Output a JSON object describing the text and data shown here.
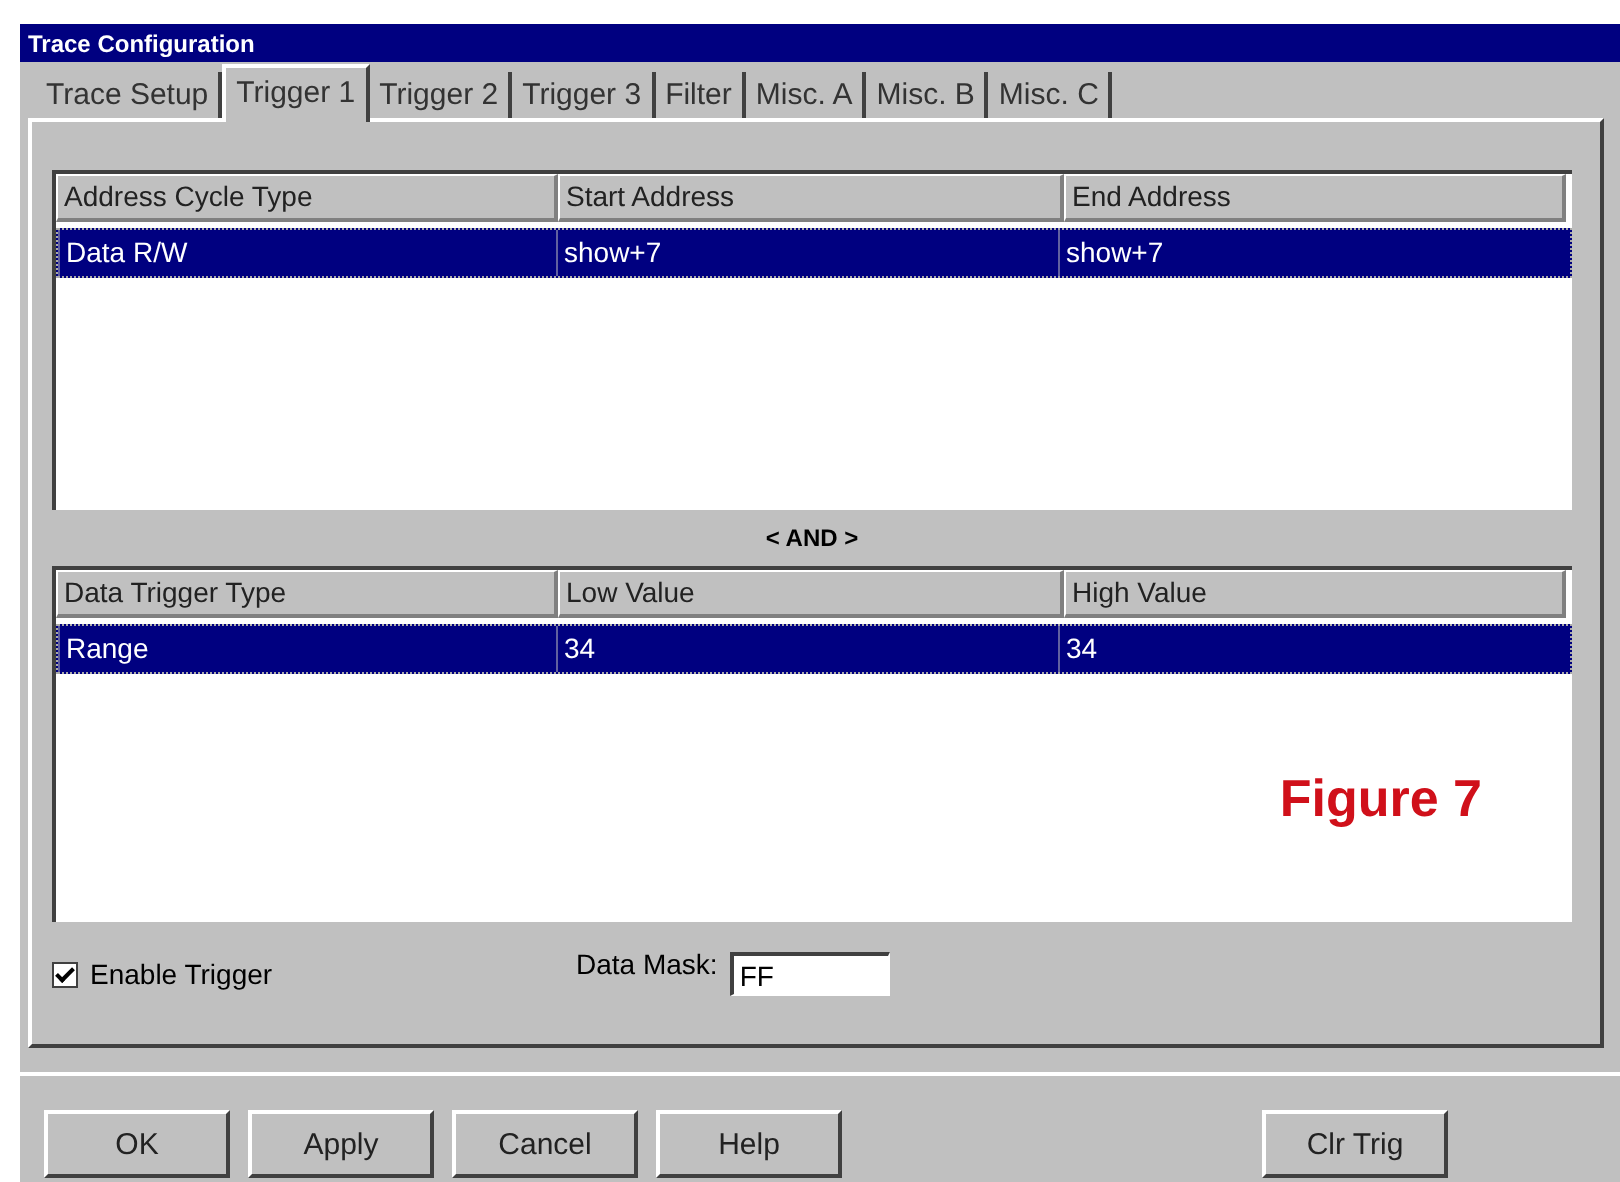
{
  "window": {
    "title": "Trace Configuration"
  },
  "tabs": [
    {
      "label": "Trace Setup",
      "selected": false
    },
    {
      "label": "Trigger 1",
      "selected": true
    },
    {
      "label": "Trigger 2",
      "selected": false
    },
    {
      "label": "Trigger 3",
      "selected": false
    },
    {
      "label": "Filter",
      "selected": false
    },
    {
      "label": "Misc. A",
      "selected": false
    },
    {
      "label": "Misc. B",
      "selected": false
    },
    {
      "label": "Misc. C",
      "selected": false
    }
  ],
  "address_table": {
    "columns": [
      "Address Cycle Type",
      "Start Address",
      "End Address"
    ],
    "rows": [
      {
        "cells": [
          "Data R/W",
          "show+7",
          "show+7"
        ],
        "selected": true
      }
    ]
  },
  "separator_label": "< AND >",
  "data_table": {
    "columns": [
      "Data Trigger Type",
      "Low Value",
      "High Value"
    ],
    "rows": [
      {
        "cells": [
          "Range",
          "34",
          "34"
        ],
        "selected": true
      }
    ]
  },
  "figure_label": "Figure 7",
  "enable_trigger": {
    "label": "Enable Trigger",
    "checked": true
  },
  "data_mask": {
    "label": "Data Mask:",
    "value": "FF"
  },
  "buttons": [
    {
      "label": "OK",
      "kind": "left"
    },
    {
      "label": "Apply",
      "kind": "left"
    },
    {
      "label": "Cancel",
      "kind": "left"
    },
    {
      "label": "Help",
      "kind": "left"
    },
    {
      "label": "Clr Trig",
      "kind": "right"
    }
  ]
}
